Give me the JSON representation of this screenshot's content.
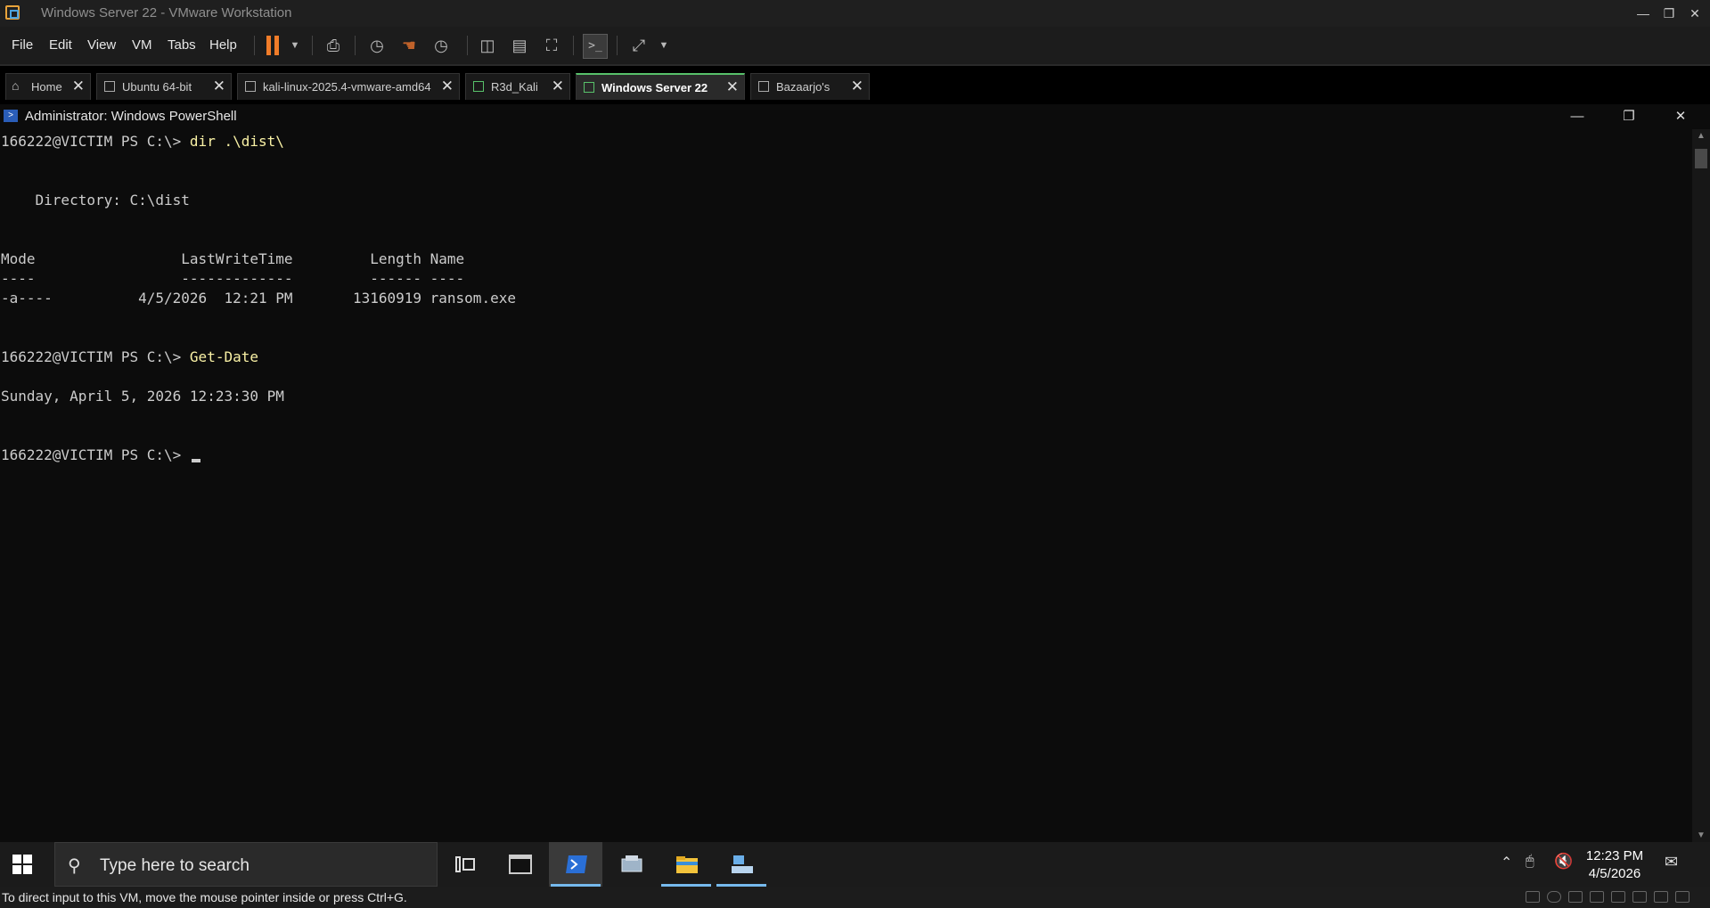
{
  "host": {
    "window_title": "Windows Server 22 - VMware Workstation",
    "menu": [
      "File",
      "Edit",
      "View",
      "VM",
      "Tabs",
      "Help"
    ],
    "tabs": [
      {
        "label": "Home",
        "active": false
      },
      {
        "label": "Ubuntu 64-bit",
        "active": false
      },
      {
        "label": "kali-linux-2025.4-vmware-amd64",
        "active": false
      },
      {
        "label": "R3d_Kali",
        "active": false
      },
      {
        "label": "Windows Server 22",
        "active": true
      },
      {
        "label": "Bazaarjo's",
        "active": false
      }
    ],
    "status_text": "To direct input to this VM, move the mouse pointer inside or press Ctrl+G.",
    "accent_color": "#f07c29"
  },
  "guest": {
    "window_title": "Administrator: Windows PowerShell",
    "console_lines": [
      {
        "prompt": "166222@VICTIM PS C:\\> ",
        "cmd": "dir .\\dist\\"
      },
      {
        "text": ""
      },
      {
        "text": ""
      },
      {
        "text": "    Directory: C:\\dist"
      },
      {
        "text": ""
      },
      {
        "text": ""
      },
      {
        "text": "Mode                 LastWriteTime         Length Name"
      },
      {
        "text": "----                 -------------         ------ ----"
      },
      {
        "text": "-a----          4/5/2026  12:21 PM       13160919 ransom.exe"
      },
      {
        "text": ""
      },
      {
        "text": ""
      },
      {
        "prompt": "166222@VICTIM PS C:\\> ",
        "cmd": "Get-Date"
      },
      {
        "text": ""
      },
      {
        "text": "Sunday, April 5, 2026 12:23:30 PM"
      },
      {
        "text": ""
      },
      {
        "text": ""
      },
      {
        "prompt": "166222@VICTIM PS C:\\> ",
        "cmd": ""
      }
    ],
    "taskbar": {
      "search_placeholder": "Type here to search",
      "clock_time": "12:23 PM",
      "clock_date": "4/5/2026"
    }
  }
}
